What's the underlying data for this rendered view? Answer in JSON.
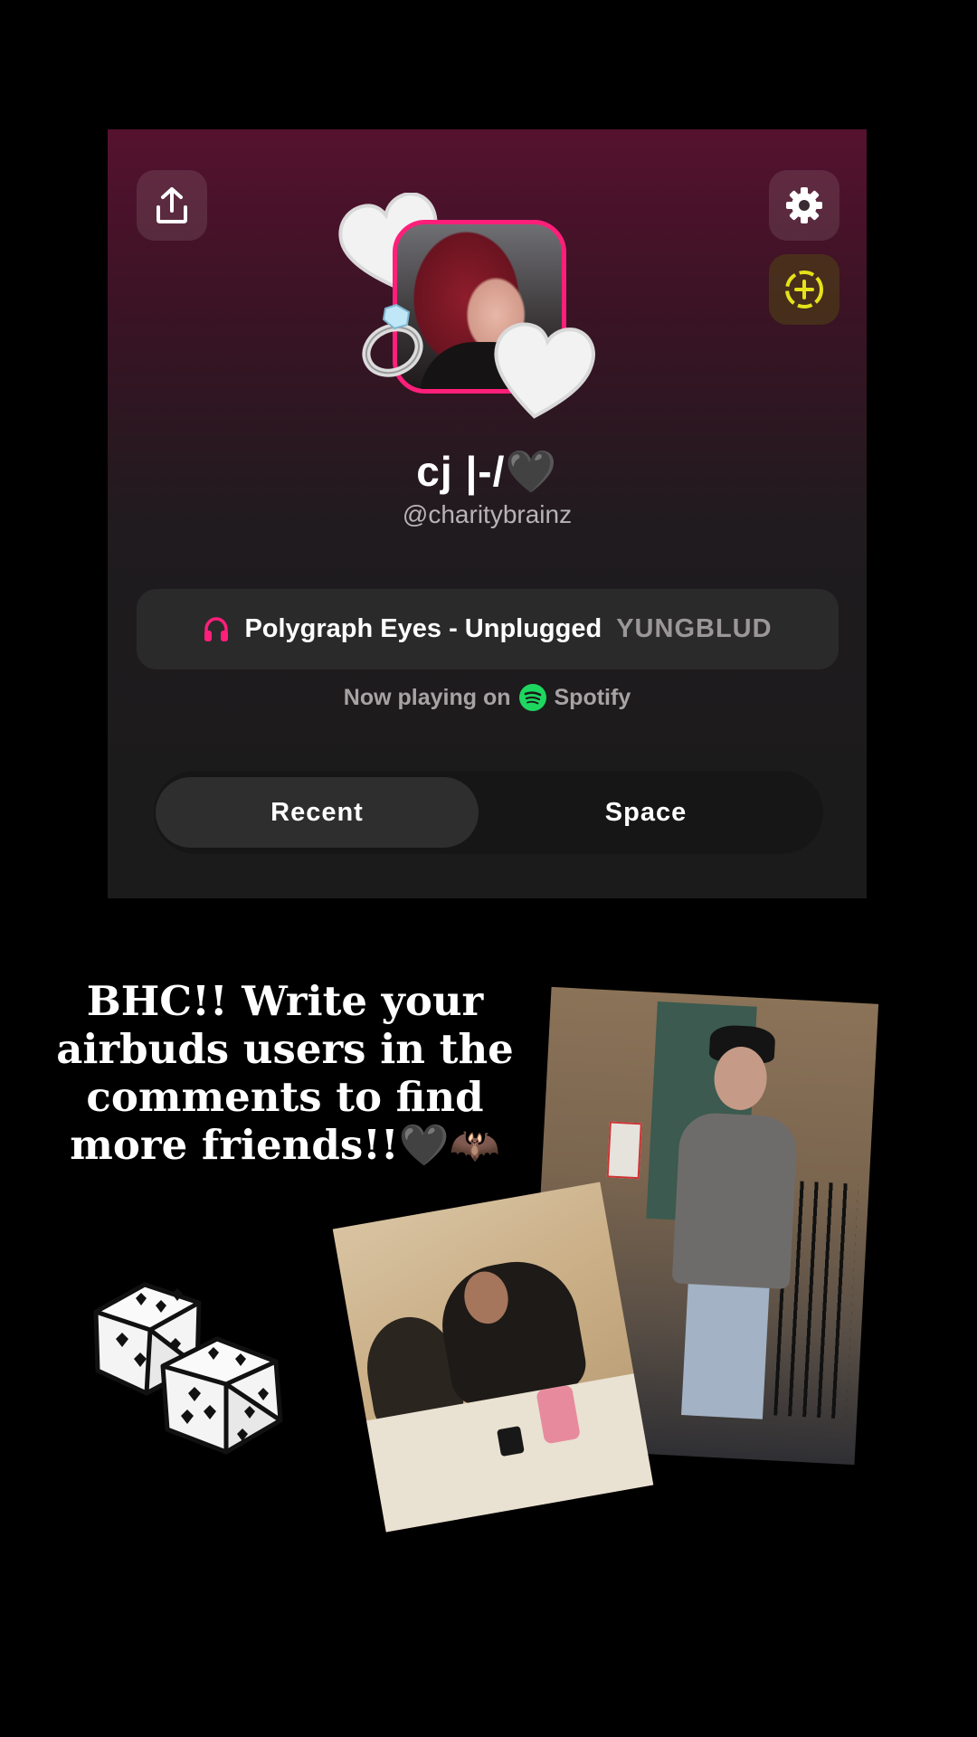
{
  "profile": {
    "display_name": "cj |-/🖤",
    "username": "@charitybrainz"
  },
  "now_playing": {
    "track": "Polygraph Eyes - Unplugged",
    "artist": "YUNGBLUD",
    "status_prefix": "Now playing on",
    "service": "Spotify"
  },
  "tabs": [
    {
      "label": "Recent"
    },
    {
      "label": "Space"
    }
  ],
  "caption": "BHC!! Write your airbuds users in the comments to find more friends!!🖤🦇",
  "colors": {
    "accent_pink": "#ff1f7a",
    "spotify_green": "#1ed760",
    "add_yellow": "#e6e21a"
  },
  "icons": [
    "share-icon",
    "gear-icon",
    "add-circle-icon",
    "headphones-icon",
    "spotify-icon",
    "heart-icon",
    "ring-icon",
    "dice-icon"
  ]
}
